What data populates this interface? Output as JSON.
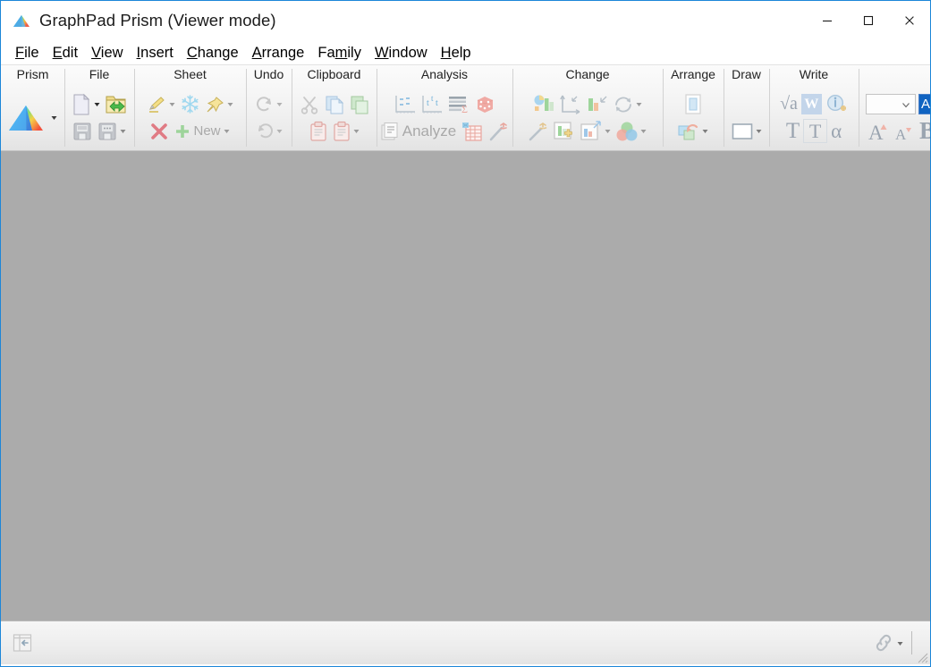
{
  "window": {
    "title": "GraphPad Prism (Viewer mode)",
    "logo_icon": "prism-logo-icon",
    "accent_border": "#1c86d8",
    "canvas_color": "#ababab",
    "controls": [
      {
        "name": "minimize",
        "label": "Minimize",
        "icon": "minimize-icon"
      },
      {
        "name": "maximize",
        "label": "Maximize",
        "icon": "maximize-icon"
      },
      {
        "name": "close",
        "label": "Close",
        "icon": "close-icon"
      }
    ]
  },
  "menubar": {
    "items": [
      {
        "pre": "",
        "key": "F",
        "post": "ile"
      },
      {
        "pre": "",
        "key": "E",
        "post": "dit"
      },
      {
        "pre": "",
        "key": "V",
        "post": "iew"
      },
      {
        "pre": "",
        "key": "I",
        "post": "nsert"
      },
      {
        "pre": "",
        "key": "C",
        "post": "hange"
      },
      {
        "pre": "",
        "key": "A",
        "post": "rrange"
      },
      {
        "pre": "Fa",
        "key": "m",
        "post": "ily"
      },
      {
        "pre": "",
        "key": "W",
        "post": "indow"
      },
      {
        "pre": "",
        "key": "H",
        "post": "elp"
      }
    ]
  },
  "ribbon": {
    "groups": [
      {
        "title": "Prism",
        "id": "prism",
        "items": [
          {
            "name": "prism-app-button",
            "icon": "prism-logo-icon",
            "caret": true,
            "enabled": true
          }
        ]
      },
      {
        "title": "File",
        "id": "file",
        "items": [
          {
            "name": "new-file-button",
            "icon": "new-document-icon",
            "caret": true,
            "enabled": true
          },
          {
            "name": "open-file-button",
            "icon": "open-folder-icon",
            "caret": false,
            "enabled": true
          },
          {
            "name": "save-button",
            "icon": "save-disk-icon",
            "caret": false,
            "enabled": false
          },
          {
            "name": "save-as-button",
            "icon": "save-as-disk-icon",
            "caret": true,
            "enabled": false
          }
        ]
      },
      {
        "title": "Sheet",
        "id": "sheet",
        "items": [
          {
            "name": "rename-sheet-button",
            "icon": "pencil-icon",
            "caret": true,
            "enabled": false
          },
          {
            "name": "freeze-sheet-button",
            "icon": "snowflake-icon",
            "caret": false,
            "enabled": false
          },
          {
            "name": "pin-sheet-button",
            "icon": "pushpin-icon",
            "caret": true,
            "enabled": false
          },
          {
            "name": "delete-sheet-button",
            "icon": "red-x-icon",
            "caret": false,
            "enabled": false
          },
          {
            "name": "new-sheet-button",
            "icon": "green-plus-icon",
            "label": "New",
            "caret": true,
            "enabled": false
          }
        ]
      },
      {
        "title": "Undo",
        "id": "undo",
        "items": [
          {
            "name": "redo-button",
            "icon": "redo-arrow-icon",
            "caret": true,
            "enabled": false
          },
          {
            "name": "undo-button",
            "icon": "undo-arrow-icon",
            "caret": true,
            "enabled": false
          }
        ]
      },
      {
        "title": "Clipboard",
        "id": "clipboard",
        "items": [
          {
            "name": "cut-button",
            "icon": "scissors-icon",
            "caret": false,
            "enabled": false
          },
          {
            "name": "copy-button",
            "icon": "copy-pages-icon",
            "caret": false,
            "enabled": false
          },
          {
            "name": "duplicate-button",
            "icon": "duplicate-icon",
            "caret": false,
            "enabled": false
          },
          {
            "name": "paste-button",
            "icon": "clipboard-icon",
            "caret": false,
            "enabled": false
          },
          {
            "name": "paste-special-button",
            "icon": "clipboard-icon",
            "caret": true,
            "enabled": false
          }
        ]
      },
      {
        "title": "Analysis",
        "id": "analysis",
        "items": [
          {
            "name": "interpolate-button",
            "icon": "scatter-axis-icon",
            "caret": false,
            "enabled": false
          },
          {
            "name": "t-test-button",
            "icon": "t-test-icon",
            "caret": false,
            "enabled": false
          },
          {
            "name": "summary-stats-button",
            "icon": "sigma-rows-icon",
            "caret": false,
            "enabled": false
          },
          {
            "name": "simulate-button",
            "icon": "dice-icon",
            "caret": false,
            "enabled": false
          },
          {
            "name": "analyze-button",
            "icon": "analyze-sheet-icon",
            "label": "Analyze",
            "caret": false,
            "enabled": false
          },
          {
            "name": "extract-data-button",
            "icon": "grid-extract-icon",
            "caret": false,
            "enabled": false
          },
          {
            "name": "analysis-wand-button",
            "icon": "magic-wand-icon",
            "caret": false,
            "enabled": false
          }
        ]
      },
      {
        "title": "Change",
        "id": "change",
        "items": [
          {
            "name": "change-graph-type-button",
            "icon": "pie-bar-icon",
            "caret": false,
            "enabled": false
          },
          {
            "name": "change-axes-button",
            "icon": "axes-icon",
            "caret": false,
            "enabled": false
          },
          {
            "name": "change-bars-button",
            "icon": "bars-arrow-icon",
            "caret": false,
            "enabled": false
          },
          {
            "name": "refresh-button",
            "icon": "circular-arrows-icon",
            "caret": true,
            "enabled": false
          },
          {
            "name": "magic-button",
            "icon": "magic-wand-icon",
            "caret": false,
            "enabled": false
          },
          {
            "name": "add-graph-button",
            "icon": "graph-plus-icon",
            "caret": false,
            "enabled": false
          },
          {
            "name": "resize-graph-button",
            "icon": "graph-resize-icon",
            "caret": true,
            "enabled": false
          },
          {
            "name": "color-scheme-button",
            "icon": "venn-colors-icon",
            "caret": true,
            "enabled": false
          }
        ]
      },
      {
        "title": "Arrange",
        "id": "arrange",
        "items": [
          {
            "name": "page-layout-button",
            "icon": "page-frame-icon",
            "caret": false,
            "enabled": false
          },
          {
            "name": "bring-forward-button",
            "icon": "layer-rotate-icon",
            "caret": true,
            "enabled": false
          }
        ]
      },
      {
        "title": "Draw",
        "id": "draw",
        "items": [
          {
            "name": "draw-rectangle-button",
            "icon": "rectangle-icon",
            "caret": true,
            "enabled": false
          }
        ]
      },
      {
        "title": "Write",
        "id": "write",
        "items": [
          {
            "name": "insert-equation-button",
            "icon": "sqrt-a-icon",
            "caret": false,
            "enabled": false
          },
          {
            "name": "insert-word-object-button",
            "icon": "word-w-icon",
            "caret": false,
            "enabled": false
          },
          {
            "name": "insert-info-button",
            "icon": "info-plus-icon",
            "caret": false,
            "enabled": false
          },
          {
            "name": "text-tool-button",
            "icon": "text-t-icon",
            "caret": false,
            "enabled": false
          },
          {
            "name": "text-box-button",
            "icon": "text-t-boxed-icon",
            "caret": false,
            "enabled": false
          },
          {
            "name": "greek-alpha-button",
            "icon": "alpha-icon",
            "caret": false,
            "enabled": false
          }
        ]
      }
    ],
    "font_controls": {
      "size_value": "",
      "size_placeholder": "",
      "name_value": "Ar",
      "grow_font": "grow-font-icon",
      "shrink_font": "shrink-font-icon",
      "bold": "bold-icon"
    }
  },
  "statusbar": {
    "collapse_panel_icon": "collapse-navigator-icon",
    "link_icon": "chain-link-icon",
    "resize_grip_icon": "resize-grip-icon"
  }
}
